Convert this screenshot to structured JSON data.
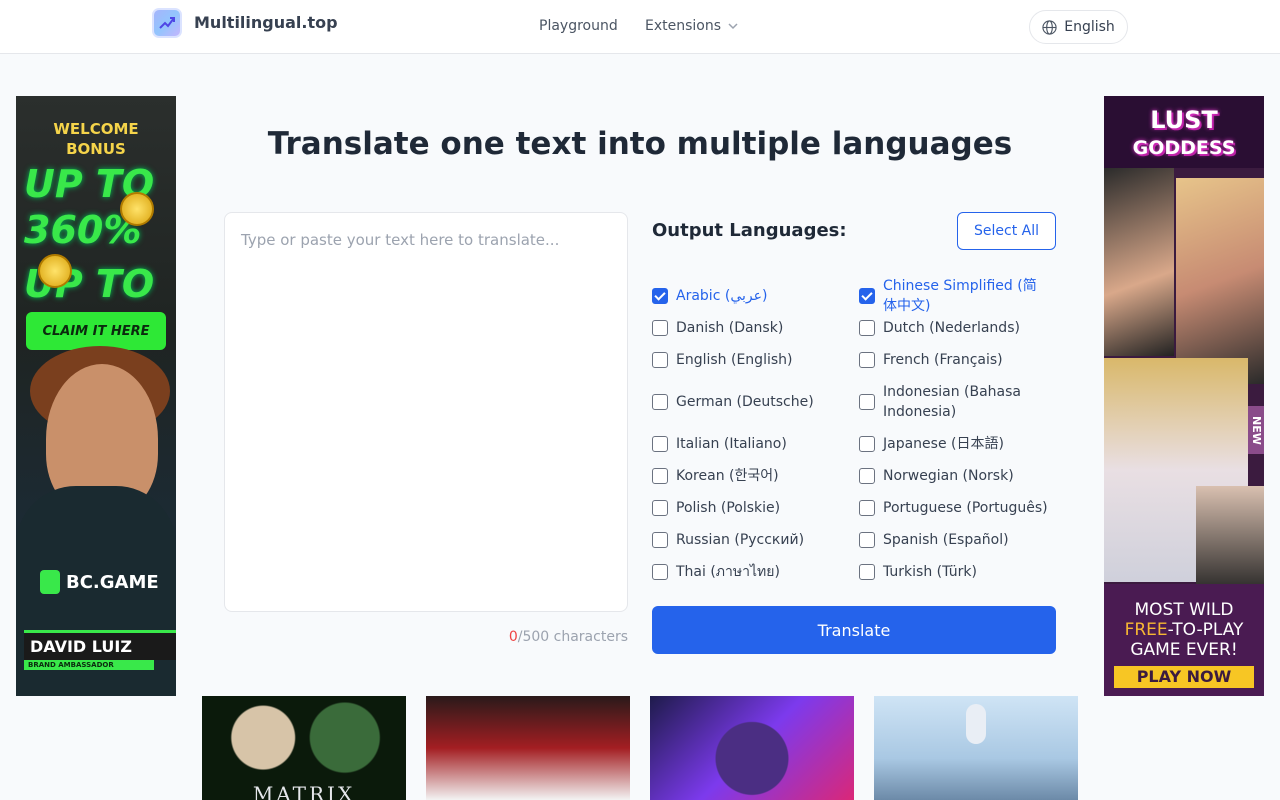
{
  "header": {
    "brand": "Multilingual.top",
    "nav": {
      "playground": "Playground",
      "extensions": "Extensions"
    },
    "language": "English"
  },
  "ads": {
    "left": {
      "line1": "WELCOME",
      "line2": "BONUS",
      "big1": "UP TO",
      "big2": "360%",
      "big3": "UP TO",
      "claim": "CLAIM IT HERE",
      "brand": "BC.GAME",
      "name": "DAVID LUIZ",
      "role": "BRAND AMBASSADOR"
    },
    "right": {
      "title1": "LUST",
      "title2": "GODDESS",
      "badge": "NEW",
      "line1": "MOST WILD",
      "free": "FREE",
      "line2": "-TO-PLAY",
      "line3": "GAME EVER!",
      "cta": "PLAY NOW"
    },
    "thumbnails": {
      "matrix_text": "MATRIX"
    }
  },
  "main": {
    "title": "Translate one text into multiple languages",
    "input": {
      "placeholder": "Type or paste your text here to translate...",
      "value": ""
    },
    "counter": {
      "count": "0",
      "suffix": "/500 characters"
    },
    "output_label": "Output Languages:",
    "select_all": "Select All",
    "translate": "Translate",
    "languages": [
      {
        "label": "Arabic (عربي)",
        "checked": true
      },
      {
        "label": "Chinese Simplified (简体中文)",
        "checked": true
      },
      {
        "label": "Danish (Dansk)",
        "checked": false
      },
      {
        "label": "Dutch (Nederlands)",
        "checked": false
      },
      {
        "label": "English (English)",
        "checked": false
      },
      {
        "label": "French (Français)",
        "checked": false
      },
      {
        "label": "German (Deutsche)",
        "checked": false
      },
      {
        "label": "Indonesian (Bahasa Indonesia)",
        "checked": false
      },
      {
        "label": "Italian (Italiano)",
        "checked": false
      },
      {
        "label": "Japanese (日本語)",
        "checked": false
      },
      {
        "label": "Korean (한국어)",
        "checked": false
      },
      {
        "label": "Norwegian (Norsk)",
        "checked": false
      },
      {
        "label": "Polish (Polskie)",
        "checked": false
      },
      {
        "label": "Portuguese (Português)",
        "checked": false
      },
      {
        "label": "Russian (Русский)",
        "checked": false
      },
      {
        "label": "Spanish (Español)",
        "checked": false
      },
      {
        "label": "Thai (ภาษาไทย)",
        "checked": false
      },
      {
        "label": "Turkish (Türk)",
        "checked": false
      }
    ]
  }
}
